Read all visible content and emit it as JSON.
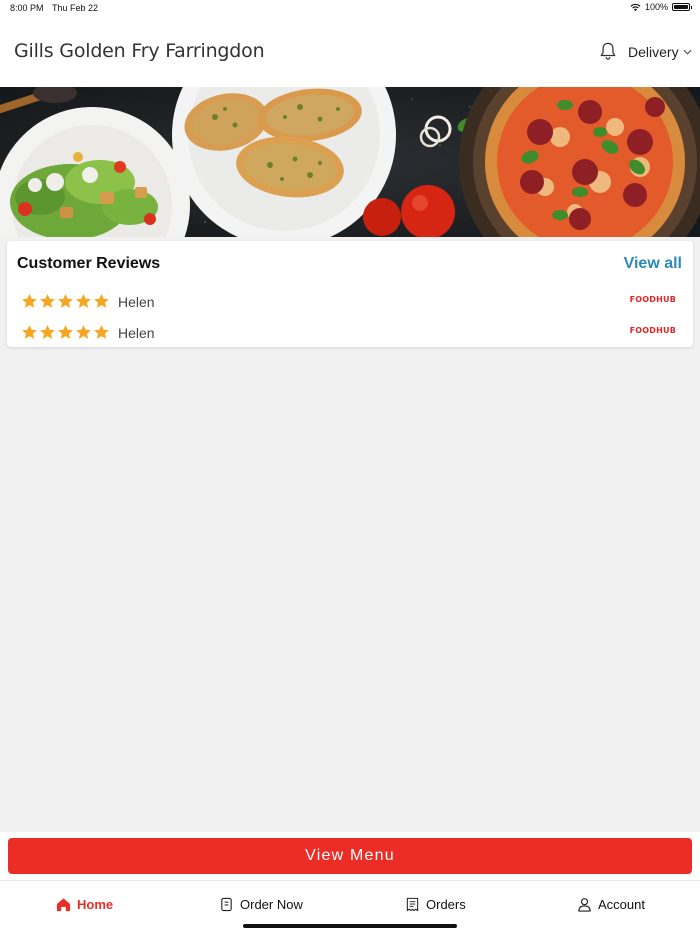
{
  "status_bar": {
    "time": "8:00 PM",
    "date": "Thu Feb 22",
    "battery": "100%"
  },
  "header": {
    "store_name": "Gills Golden Fry Farringdon",
    "delivery_label": "Delivery",
    "bell_icon": "bell-icon",
    "chevron_icon": "chevron-down-icon"
  },
  "reviews": {
    "title": "Customer Reviews",
    "view_all": "View all",
    "items": [
      {
        "rating": 5,
        "name": "Helen",
        "source": "FOODHUB"
      },
      {
        "rating": 5,
        "name": "Helen",
        "source": "FOODHUB"
      }
    ]
  },
  "view_menu_label": "View Menu",
  "tabs": [
    {
      "label": "Home",
      "icon": "home-icon",
      "active": true
    },
    {
      "label": "Order Now",
      "icon": "order-now-icon",
      "active": false
    },
    {
      "label": "Orders",
      "icon": "receipt-icon",
      "active": false
    },
    {
      "label": "Account",
      "icon": "user-icon",
      "active": false
    }
  ],
  "colors": {
    "accent": "#ec2d27",
    "link": "#2a8ab8",
    "star": "#f5a623"
  }
}
